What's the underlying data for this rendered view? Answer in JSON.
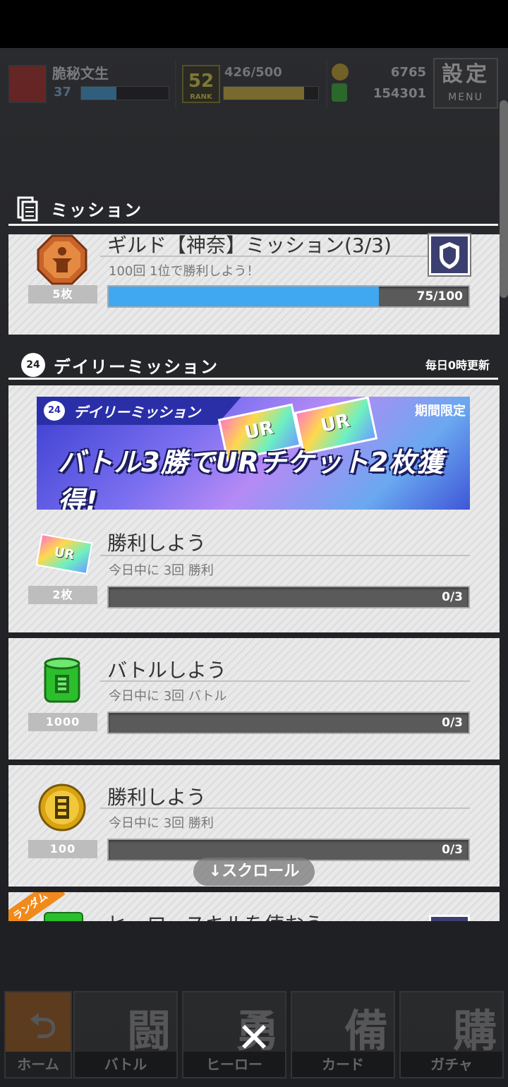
{
  "header": {
    "player_name": "脆秘文生",
    "level": "37",
    "rank": "52",
    "rank_label": "RANK",
    "stamina": "426/500",
    "coins": "6765",
    "gems": "154301",
    "menu_big": "設定",
    "menu_small": "MENU"
  },
  "mission_section": {
    "title": "ミッション",
    "guild": {
      "title": "ギルド【神奈】ミッション(3/3)",
      "desc": "100回 1位で勝利しよう！",
      "reward": "5枚",
      "progress_text": "75/100",
      "progress": 0.75
    }
  },
  "daily_section": {
    "title": "デイリーミッション",
    "badge": "24",
    "refresh_note": "毎日0時更新",
    "banner": {
      "tag_number": "24",
      "tag": "デイリーミッション",
      "limited": "期間限定",
      "headline": "バトル3勝でURチケット2枚獲得!",
      "ticket_text": "UR"
    },
    "missions": [
      {
        "title": "勝利しよう",
        "desc": "今日中に 3回 勝利",
        "reward": "2枚",
        "progress_text": "0/3",
        "progress": 0
      },
      {
        "title": "バトルしよう",
        "desc": "今日中に 3回 バトル",
        "reward": "1000",
        "progress_text": "0/3",
        "progress": 0
      },
      {
        "title": "勝利しよう",
        "desc": "今日中に 3回 勝利",
        "reward": "100",
        "progress_text": "0/3",
        "progress": 0
      }
    ],
    "partial_card": {
      "ribbon": "ランダム",
      "title": "ヒーロースキルを使おう"
    }
  },
  "scroll_hint": "↓スクロール",
  "bottom_nav": [
    {
      "kanji": "",
      "label": "ホーム"
    },
    {
      "kanji": "闘",
      "label": "バトル"
    },
    {
      "kanji": "勇",
      "label": "ヒーロー"
    },
    {
      "kanji": "備",
      "label": "カード"
    },
    {
      "kanji": "購",
      "label": "ガチャ"
    }
  ],
  "close_symbol": "✕",
  "colors": {
    "progress_blue": "#3fa8f0",
    "panel_bg": "#e6e6e8",
    "banner_purple": "#7b6ff0"
  }
}
